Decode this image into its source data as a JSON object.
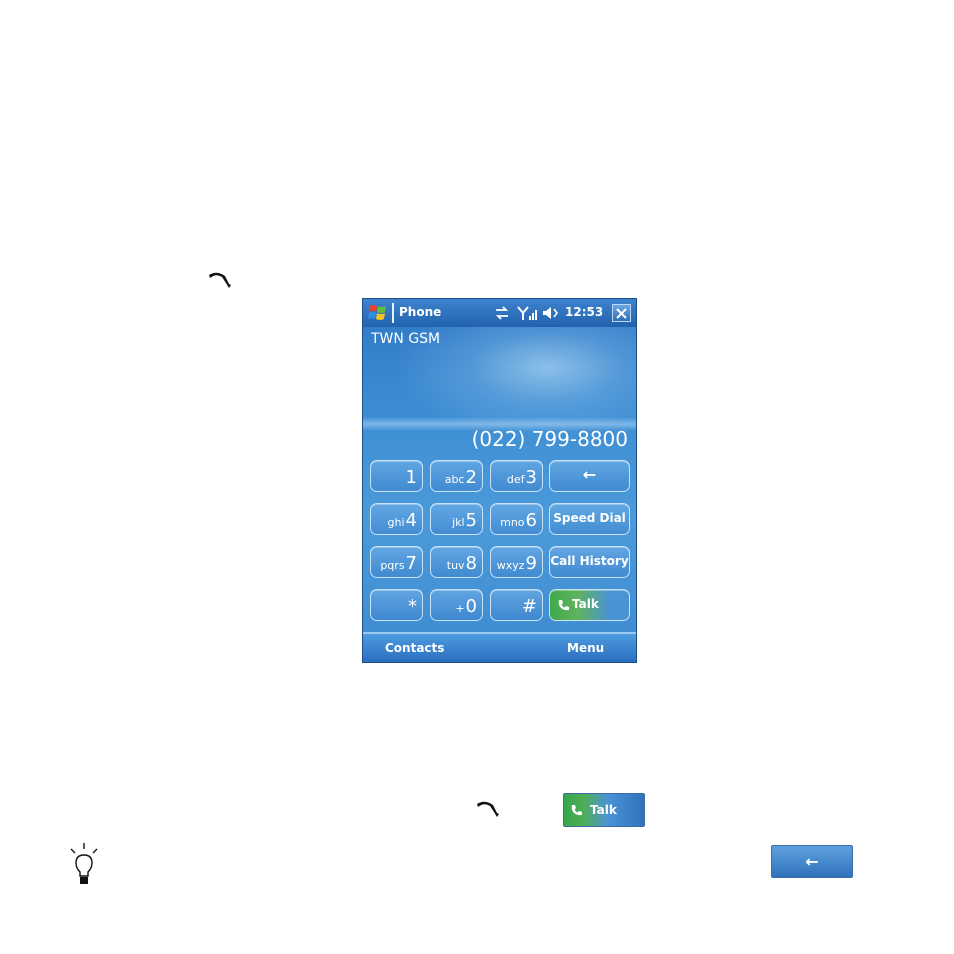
{
  "phone": {
    "title": "Phone",
    "time": "12:53",
    "operator": "TWN GSM",
    "number": "(022) 799-8800",
    "keys": [
      {
        "digit": "1",
        "letters": ""
      },
      {
        "digit": "2",
        "letters": "abc"
      },
      {
        "digit": "3",
        "letters": "def"
      },
      {
        "digit": "4",
        "letters": "ghi"
      },
      {
        "digit": "5",
        "letters": "jkl"
      },
      {
        "digit": "6",
        "letters": "mno"
      },
      {
        "digit": "7",
        "letters": "pqrs"
      },
      {
        "digit": "8",
        "letters": "tuv"
      },
      {
        "digit": "9",
        "letters": "wxyz"
      },
      {
        "digit": "*",
        "letters": ""
      },
      {
        "digit": "0",
        "letters": "+"
      },
      {
        "digit": "#",
        "letters": ""
      }
    ],
    "backspace_label": "←",
    "speed_dial_label": "Speed Dial",
    "call_history_label": "Call History",
    "talk_label": "Talk",
    "softkeys": {
      "left": "Contacts",
      "right": "Menu"
    }
  },
  "inline": {
    "talk_label": "Talk",
    "backspace_label": "←"
  },
  "icons": [
    "handset-icon",
    "windows-logo-icon",
    "connectivity-icon",
    "signal-icon",
    "speaker-icon",
    "close-icon",
    "lightbulb-icon",
    "phone-icon"
  ],
  "colors": {
    "screen_blue": "#3f8fd4",
    "talk_green": "#3faa4a",
    "title_blue": "#2262ad"
  }
}
